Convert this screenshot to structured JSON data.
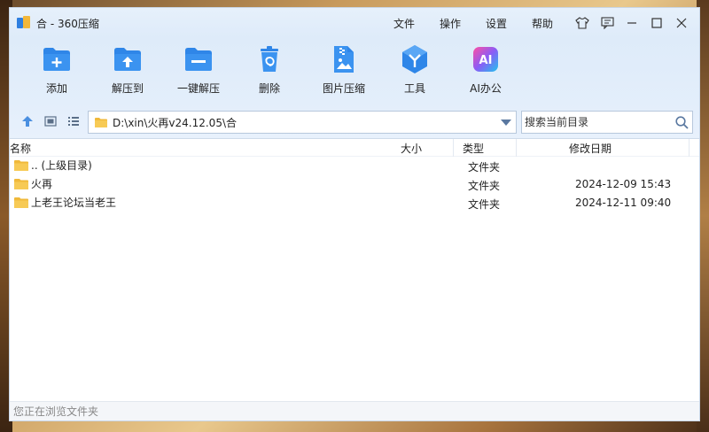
{
  "window": {
    "title": "合 - 360压缩",
    "menu": [
      "文件",
      "操作",
      "设置",
      "帮助"
    ]
  },
  "toolbar": {
    "buttons": [
      {
        "label": "添加",
        "icon": "add-folder-icon"
      },
      {
        "label": "解压到",
        "icon": "extract-to-icon"
      },
      {
        "label": "一键解压",
        "icon": "one-click-extract-icon"
      },
      {
        "label": "删除",
        "icon": "delete-icon"
      },
      {
        "label": "图片压缩",
        "icon": "image-compress-icon"
      },
      {
        "label": "工具",
        "icon": "tools-icon"
      },
      {
        "label": "AI办公",
        "icon": "ai-office-icon"
      }
    ],
    "accent": "#2f86e8"
  },
  "address": {
    "path": "D:\\xin\\火再v24.12.05\\合",
    "search_placeholder": "搜索当前目录"
  },
  "table": {
    "columns": [
      "名称",
      "大小",
      "类型",
      "修改日期"
    ],
    "rows": [
      {
        "name": ".. (上级目录)",
        "size": "",
        "type": "文件夹",
        "date": ""
      },
      {
        "name": "火再",
        "size": "",
        "type": "文件夹",
        "date": "2024-12-09 15:43"
      },
      {
        "name": "上老王论坛当老王",
        "size": "",
        "type": "文件夹",
        "date": "2024-12-11 09:40"
      }
    ]
  },
  "status": {
    "text": "您正在浏览文件夹"
  }
}
